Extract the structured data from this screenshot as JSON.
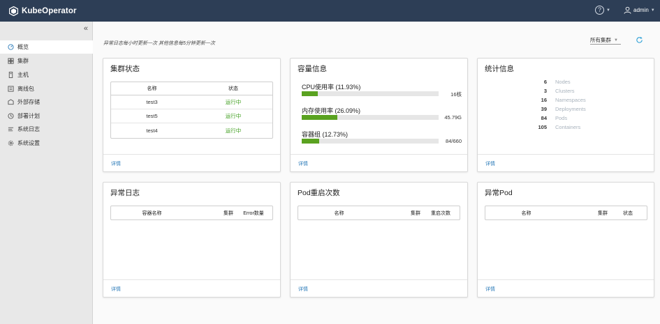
{
  "header": {
    "app_name": "KubeOperator",
    "help_icon": "?",
    "user": "admin"
  },
  "sidebar": {
    "collapse_icon": "«",
    "items": [
      {
        "label": "概览",
        "icon": "dashboard-icon",
        "active": true
      },
      {
        "label": "集群",
        "icon": "cluster-icon"
      },
      {
        "label": "主机",
        "icon": "host-icon"
      },
      {
        "label": "离线包",
        "icon": "package-icon"
      },
      {
        "label": "外部存储",
        "icon": "storage-icon"
      },
      {
        "label": "部署计划",
        "icon": "clock-icon"
      },
      {
        "label": "系统日志",
        "icon": "log-icon"
      },
      {
        "label": "系统设置",
        "icon": "gear-icon"
      }
    ]
  },
  "toolbar": {
    "notice": "异常日志每小时更新一次 其他信息每5分钟更新一次",
    "cluster_select": "所有集群"
  },
  "cluster_status": {
    "title": "集群状态",
    "columns": [
      "名称",
      "状态"
    ],
    "rows": [
      {
        "name": "test3",
        "status": "运行中"
      },
      {
        "name": "test5",
        "status": "运行中"
      },
      {
        "name": "test4",
        "status": "运行中"
      }
    ],
    "footer": "详情"
  },
  "capacity": {
    "title": "容量信息",
    "items": [
      {
        "label": "CPU使用率 (11.93%)",
        "percent": 11.93,
        "value": "16核"
      },
      {
        "label": "内存使用率 (26.09%)",
        "percent": 26.09,
        "value": "45.79G"
      },
      {
        "label": "容器组 (12.73%)",
        "percent": 12.73,
        "value": "84/660"
      }
    ],
    "footer": "详情"
  },
  "statistics": {
    "title": "统计信息",
    "items": [
      {
        "count": "6",
        "name": "Nodes"
      },
      {
        "count": "3",
        "name": "Clusters"
      },
      {
        "count": "16",
        "name": "Namespaces"
      },
      {
        "count": "39",
        "name": "Deployments"
      },
      {
        "count": "84",
        "name": "Pods"
      },
      {
        "count": "105",
        "name": "Containers"
      }
    ],
    "footer": "详情"
  },
  "error_logs": {
    "title": "异常日志",
    "columns": [
      "容器名称",
      "集群",
      "Error数量"
    ],
    "footer": "详情"
  },
  "pod_restarts": {
    "title": "Pod重启次数",
    "columns": [
      "名称",
      "集群",
      "重启次数"
    ],
    "footer": "详情"
  },
  "abnormal_pods": {
    "title": "异常Pod",
    "columns": [
      "名称",
      "集群",
      "状态"
    ],
    "footer": "详情"
  },
  "colors": {
    "header_bg": "#2d3e56",
    "accent_green": "#5aa220",
    "link_blue": "#2b7bb9",
    "running_green": "#3f9e1e"
  }
}
